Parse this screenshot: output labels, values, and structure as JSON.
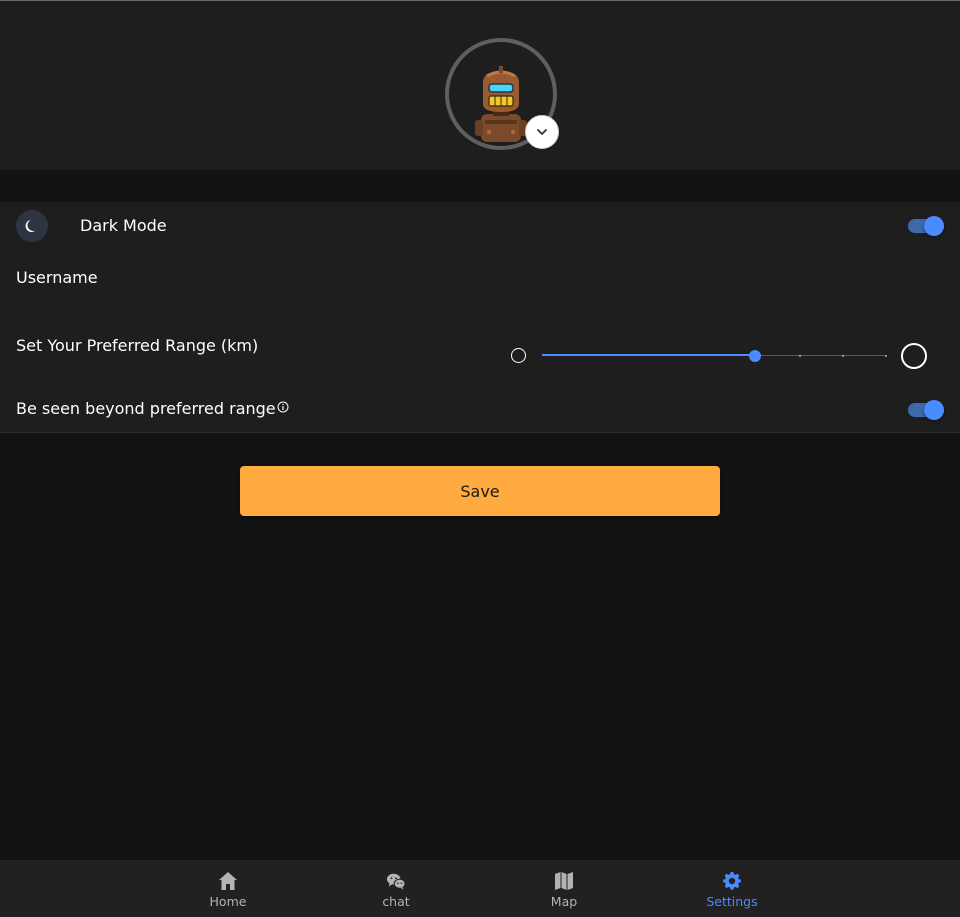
{
  "settings": {
    "dark_mode_label": "Dark Mode",
    "dark_mode_on": true,
    "username_label": "Username",
    "range_label": "Set Your Preferred Range (km)",
    "range_value_fraction": 0.62,
    "range_ticks": 9,
    "beyond_label": "Be seen beyond preferred range",
    "beyond_on": true,
    "save_label": "Save"
  },
  "nav": {
    "items": [
      {
        "label": "Home",
        "icon": "home-icon",
        "active": false
      },
      {
        "label": "chat",
        "icon": "wechat-icon",
        "active": false
      },
      {
        "label": "Map",
        "icon": "map-icon",
        "active": false
      },
      {
        "label": "Settings",
        "icon": "gear-icon",
        "active": true
      }
    ]
  },
  "colors": {
    "background": "#121212",
    "surface": "#1e1e1e",
    "accent": "#4a8cff",
    "save": "#ffab40"
  }
}
